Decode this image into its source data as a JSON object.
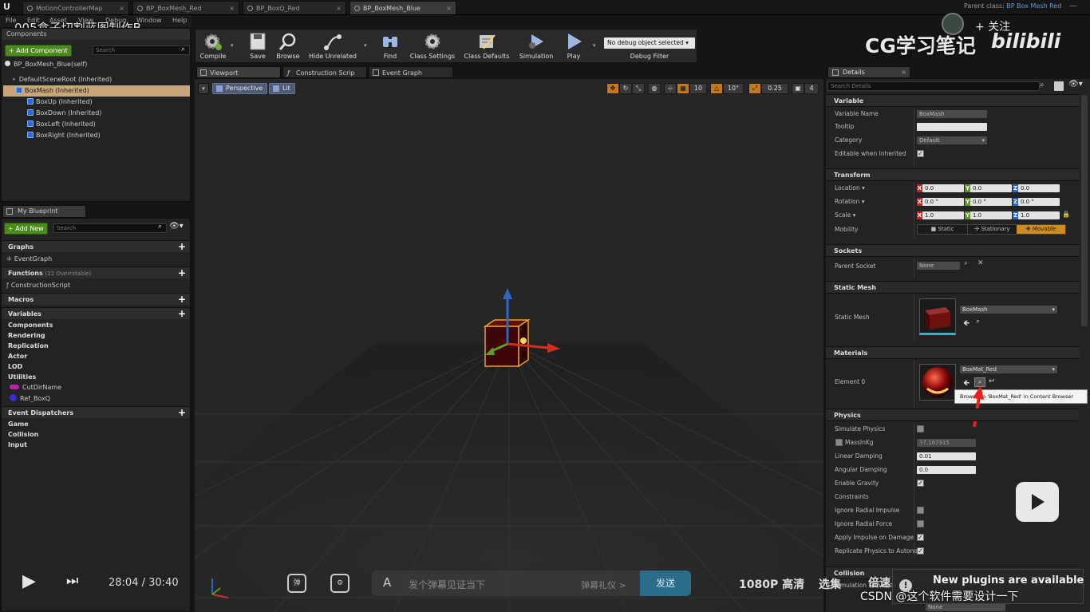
{
  "app": {
    "logo": "U"
  },
  "tabs": [
    {
      "label": "MotionControllerMap"
    },
    {
      "label": "BP_BoxMesh_Red"
    },
    {
      "label": "BP_BoxQ_Red"
    },
    {
      "label": "BP_BoxMesh_Blue"
    }
  ],
  "menu": [
    "File",
    "Edit",
    "Asset",
    "View",
    "Debug",
    "Window",
    "Help"
  ],
  "overlay": {
    "video_title": "005盒子切割蓝图制作B",
    "brand_text": "CG学习笔记",
    "brand_logo": "bilibili",
    "follow": "+ 关注",
    "parent_class_label": "Parent class:",
    "parent_class_value": "BP Box Mesh Red",
    "time_current": "28:04",
    "time_sep": "/",
    "time_total": "30:40",
    "danmaku_placeholder": "发个弹幕见证当下",
    "danmaku_etiquette": "弹幕礼仪 >",
    "send": "发送",
    "quality": "1080P 高清",
    "select_ep": "选集",
    "speed": "倍速",
    "csdn_watermark": "CSDN @这个软件需要设计一下",
    "notice": "New plugins are available"
  },
  "components": {
    "title": "Components",
    "add_button": "+ Add Component",
    "search_placeholder": "Search",
    "self": "BP_BoxMesh_Blue(self)",
    "tree": [
      {
        "label": "DefaultSceneRoot (Inherited)",
        "level": 0,
        "selected": false
      },
      {
        "label": "BoxMash (Inherited)",
        "level": 1,
        "selected": true
      },
      {
        "label": "BoxUp (Inherited)",
        "level": 2,
        "selected": false
      },
      {
        "label": "BoxDown (Inherited)",
        "level": 2,
        "selected": false
      },
      {
        "label": "BoxLeft (Inherited)",
        "level": 2,
        "selected": false
      },
      {
        "label": "BoxRight (Inherited)",
        "level": 2,
        "selected": false
      }
    ]
  },
  "my_blueprint": {
    "title": "My Blueprint",
    "add_new": "+ Add New",
    "search_placeholder": "Search",
    "graphs": "Graphs",
    "event_graph": "EventGraph",
    "functions": "Functions",
    "functions_count": "(22 Overridable)",
    "construction_script": "ConstructionScript",
    "macros": "Macros",
    "variables": "Variables",
    "var_categories": [
      "Components",
      "Rendering",
      "Replication",
      "Actor",
      "LOD",
      "Utilities"
    ],
    "var_items": [
      {
        "label": "CutDirName",
        "color": "#c21fb0"
      },
      {
        "label": "Ref_BoxQ",
        "color": "#3a2bd6"
      }
    ],
    "event_dispatchers": "Event Dispatchers",
    "dispatcher_categories": [
      "Game",
      "Collision",
      "Input"
    ]
  },
  "toolbar": {
    "items": [
      {
        "label": "Compile"
      },
      {
        "label": "Save"
      },
      {
        "label": "Browse"
      },
      {
        "label": "Hide Unrelated"
      },
      {
        "label": "Find"
      },
      {
        "label": "Class Settings"
      },
      {
        "label": "Class Defaults"
      },
      {
        "label": "Simulation"
      },
      {
        "label": "Play"
      }
    ],
    "debug_select": "No debug object selected",
    "debug_filter": "Debug Filter"
  },
  "editor_tabs": [
    {
      "label": "Viewport"
    },
    {
      "label": "Construction Scrip"
    },
    {
      "label": "Event Graph"
    }
  ],
  "viewport": {
    "perspective": "Perspective",
    "lit": "Lit",
    "grid_snap": "10",
    "rot_snap": "10°",
    "scale_snap": "0.25",
    "cam_speed": "4"
  },
  "details": {
    "tab": "Details",
    "search_placeholder": "Search Details",
    "sections": {
      "variable": "Variable",
      "transform": "Transform",
      "sockets": "Sockets",
      "static_mesh": "Static Mesh",
      "materials": "Materials",
      "physics": "Physics",
      "collision": "Collision"
    },
    "variable_name_label": "Variable Name",
    "variable_name_value": "BoxMash",
    "tooltip_label": "Tooltip",
    "category_label": "Category",
    "category_value": "Default",
    "editable_label": "Editable when Inherited",
    "location_label": "Location",
    "location": [
      "0.0",
      "0.0",
      "0.0"
    ],
    "rotation_label": "Rotation",
    "rotation": [
      "0.0 °",
      "0.0 °",
      "0.0 °"
    ],
    "scale_label": "Scale",
    "scale": [
      "1.0",
      "1.0",
      "1.0"
    ],
    "mobility_label": "Mobility",
    "mobility_options": [
      "Static",
      "Stationary",
      "Movable"
    ],
    "parent_socket_label": "Parent Socket",
    "parent_socket_value": "None",
    "static_mesh_label": "Static Mesh",
    "static_mesh_value": "BoxMash",
    "element0_label": "Element 0",
    "element0_value": "BoxMat_Red",
    "tooltip_browse": "Browse to 'BoxMat_Red' in Content Browser",
    "physics_rows": [
      {
        "label": "Simulate Physics",
        "type": "check",
        "checked": false
      },
      {
        "label": "MassInKg",
        "type": "field",
        "value": "37.167915"
      },
      {
        "label": "Linear Damping",
        "type": "field",
        "value": "0.01"
      },
      {
        "label": "Angular Damping",
        "type": "field",
        "value": "0.0"
      },
      {
        "label": "Enable Gravity",
        "type": "check",
        "checked": true
      },
      {
        "label": "Constraints",
        "type": "group"
      },
      {
        "label": "Ignore Radial Impulse",
        "type": "check",
        "checked": false
      },
      {
        "label": "Ignore Radial Force",
        "type": "check",
        "checked": false
      },
      {
        "label": "Apply Impulse on Damage",
        "type": "check",
        "checked": true
      },
      {
        "label": "Replicate Physics to Autono",
        "type": "check",
        "checked": true
      }
    ],
    "collision_row": "Simulation Generate",
    "collision_value": "None"
  },
  "colors": {
    "accent_green": "#4b8a1f",
    "selection": "#c9a679",
    "movable": "#d08b1d",
    "x": "#c0271f",
    "y": "#5f9b1e",
    "z": "#2a67c8"
  }
}
